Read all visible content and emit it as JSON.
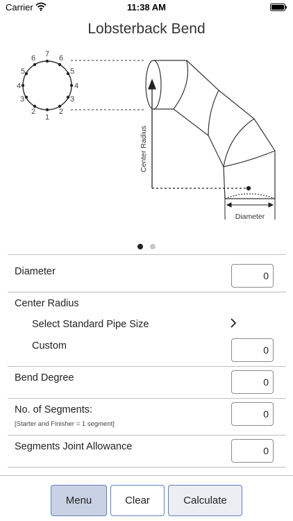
{
  "status_bar": {
    "carrier": "Carrier",
    "time": "11:38 AM"
  },
  "title": "Lobsterback Bend",
  "diagram": {
    "joint_labels_left": [
      "6",
      "5",
      "4",
      "3",
      "2"
    ],
    "joint_labels_right": [
      "6",
      "5",
      "4",
      "3",
      "2"
    ],
    "joint_label_top": "7",
    "joint_label_bottom": "1",
    "center_radius_label": "Center Radius",
    "diameter_label": "Diameter"
  },
  "pager": {
    "pages": 2,
    "active": 0
  },
  "form": {
    "diameter": {
      "label": "Diameter",
      "value": "0"
    },
    "center_radius": {
      "label": "Center Radius"
    },
    "standard_pipe": {
      "label": "Select Standard Pipe Size"
    },
    "custom": {
      "label": "Custom",
      "value": "0"
    },
    "bend_degree": {
      "label": "Bend Degree",
      "value": "0"
    },
    "segments": {
      "label": "No. of Segments:",
      "note": "[Starter and Finisher = 1 segment]",
      "value": "0"
    },
    "joint_allowance": {
      "label": "Segments Joint Allowance",
      "value": "0"
    }
  },
  "toolbar": {
    "menu": "Menu",
    "clear": "Clear",
    "calculate": "Calculate"
  }
}
